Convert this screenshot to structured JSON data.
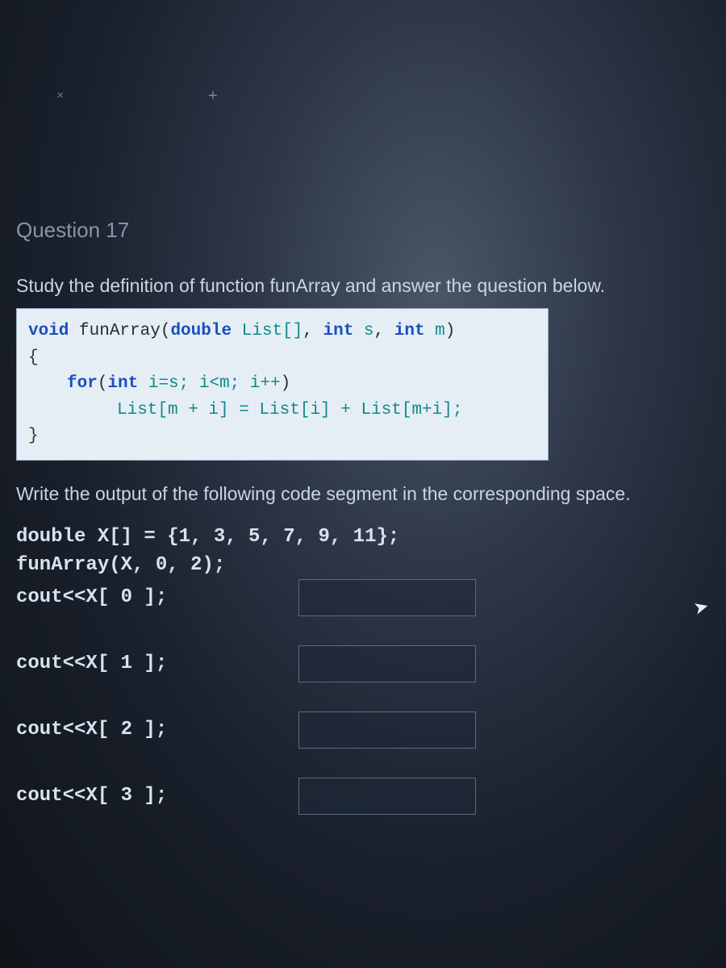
{
  "browser": {
    "tab_hint": "×",
    "plus": "+",
    "address_hint": ""
  },
  "question": {
    "title": "Question 17",
    "intro": "Study the definition of function funArray and answer the question below.",
    "code": {
      "sig_void": "void",
      "sig_name": " funArray",
      "sig_open": "(",
      "sig_double": "double",
      "sig_list": " List[]",
      "sig_comma1": ", ",
      "sig_int1": "int",
      "sig_s": " s",
      "sig_comma2": ", ",
      "sig_int2": "int",
      "sig_m": " m",
      "sig_close": ")",
      "lbrace": "{",
      "for_kw": "for",
      "for_open": "(",
      "for_int": "int",
      "for_init": " i=s; i<m; i++",
      "for_close": ")",
      "body": "List[m + i] = List[i] + List[m+i];",
      "rbrace": "}"
    },
    "prompt2": "Write the output of the following code segment in the corresponding space.",
    "snippet_line1": "double X[] = {1, 3, 5, 7, 9, 11};",
    "snippet_line2": "funArray(X, 0, 2);",
    "outputs": [
      {
        "label": "cout<<X[ 0 ];",
        "value": ""
      },
      {
        "label": "cout<<X[ 1 ];",
        "value": ""
      },
      {
        "label": "cout<<X[ 2 ];",
        "value": ""
      },
      {
        "label": "cout<<X[ 3 ];",
        "value": ""
      }
    ]
  }
}
